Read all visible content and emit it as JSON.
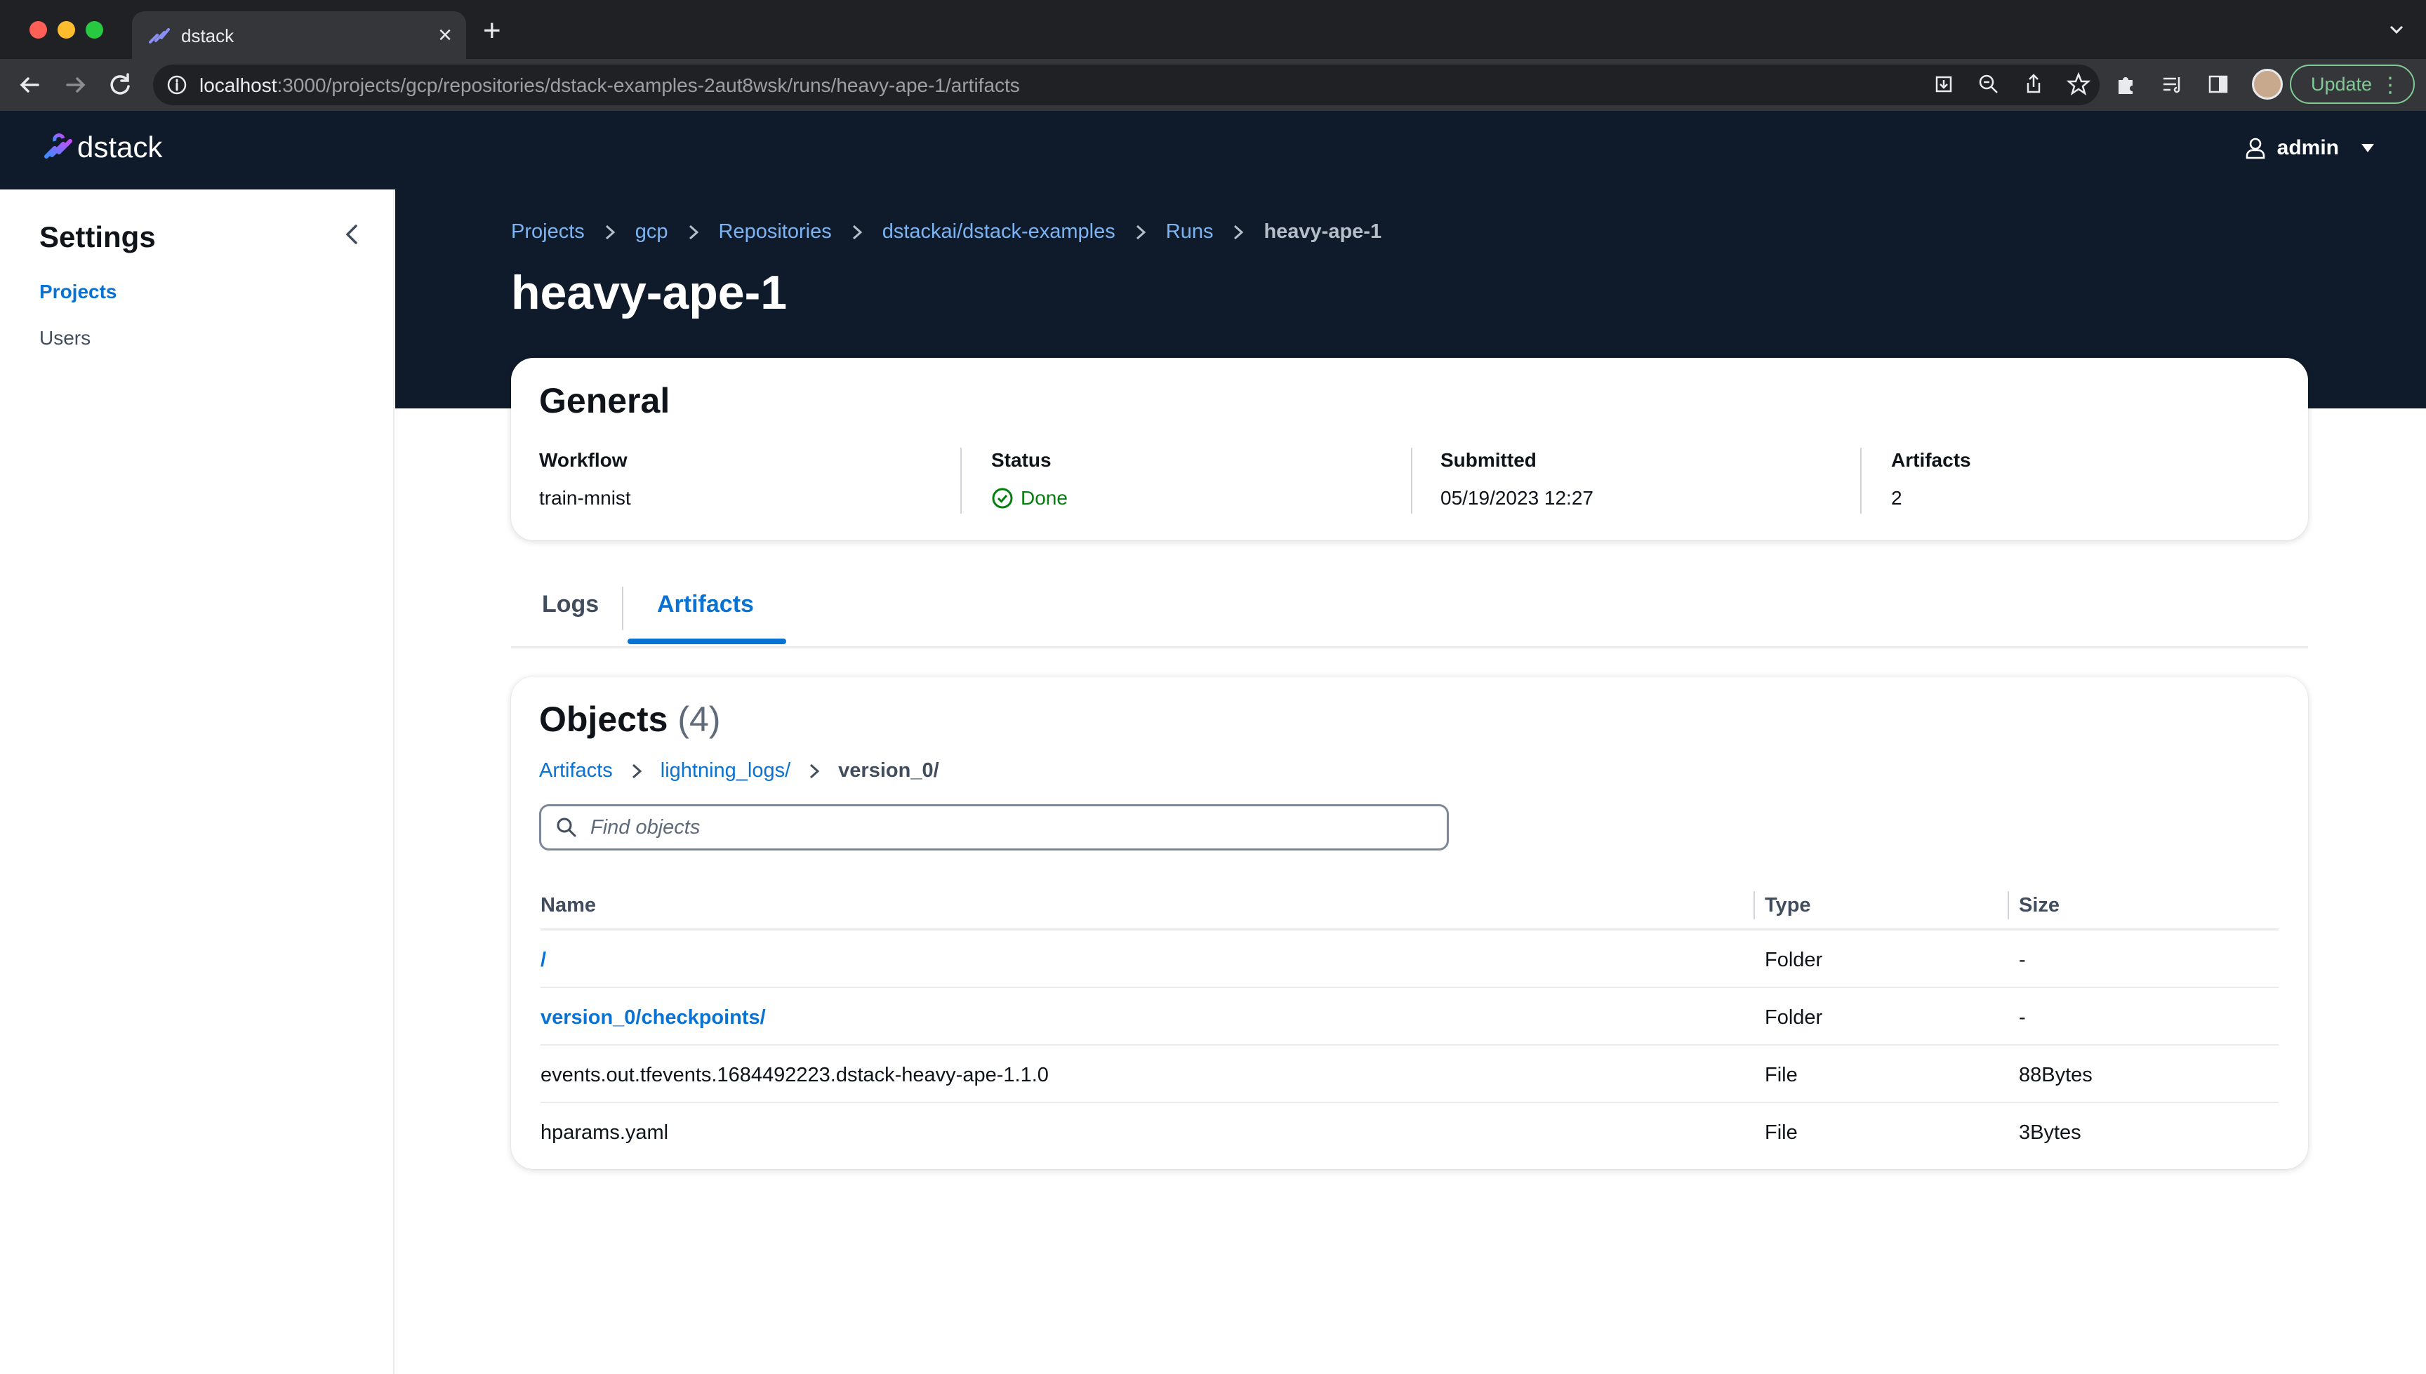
{
  "browser": {
    "tab_title": "dstack",
    "url_host": "localhost",
    "url_path": ":3000/projects/gcp/repositories/dstack-examples-2aut8wsk/runs/heavy-ape-1/artifacts",
    "update_label": "Update"
  },
  "header": {
    "brand": "dstack",
    "user": "admin"
  },
  "sidebar": {
    "title": "Settings",
    "items": [
      {
        "label": "Projects",
        "active": true
      },
      {
        "label": "Users",
        "active": false
      }
    ]
  },
  "breadcrumbs": [
    "Projects",
    "gcp",
    "Repositories",
    "dstackai/dstack-examples",
    "Runs",
    "heavy-ape-1"
  ],
  "page_title": "heavy-ape-1",
  "general": {
    "title": "General",
    "fields": [
      {
        "key": "Workflow",
        "value": "train-mnist"
      },
      {
        "key": "Status",
        "value": "Done"
      },
      {
        "key": "Submitted",
        "value": "05/19/2023 12:27"
      },
      {
        "key": "Artifacts",
        "value": "2"
      }
    ]
  },
  "tabs": [
    {
      "label": "Logs",
      "active": false
    },
    {
      "label": "Artifacts",
      "active": true
    }
  ],
  "objects": {
    "title": "Objects",
    "count": "(4)",
    "path": [
      "Artifacts",
      "lightning_logs/",
      "version_0/"
    ],
    "search_placeholder": "Find objects",
    "columns": [
      "Name",
      "Type",
      "Size"
    ],
    "rows": [
      {
        "name": "/",
        "type": "Folder",
        "size": "-",
        "is_link": true
      },
      {
        "name": "version_0/checkpoints/",
        "type": "Folder",
        "size": "-",
        "is_link": true
      },
      {
        "name": "events.out.tfevents.1684492223.dstack-heavy-ape-1.1.0",
        "type": "File",
        "size": "88Bytes",
        "is_link": false
      },
      {
        "name": "hparams.yaml",
        "type": "File",
        "size": "3Bytes",
        "is_link": false
      }
    ]
  },
  "colors": {
    "header_bg": "#0f1b2a",
    "link": "#0972d3",
    "success": "#037f0c"
  }
}
